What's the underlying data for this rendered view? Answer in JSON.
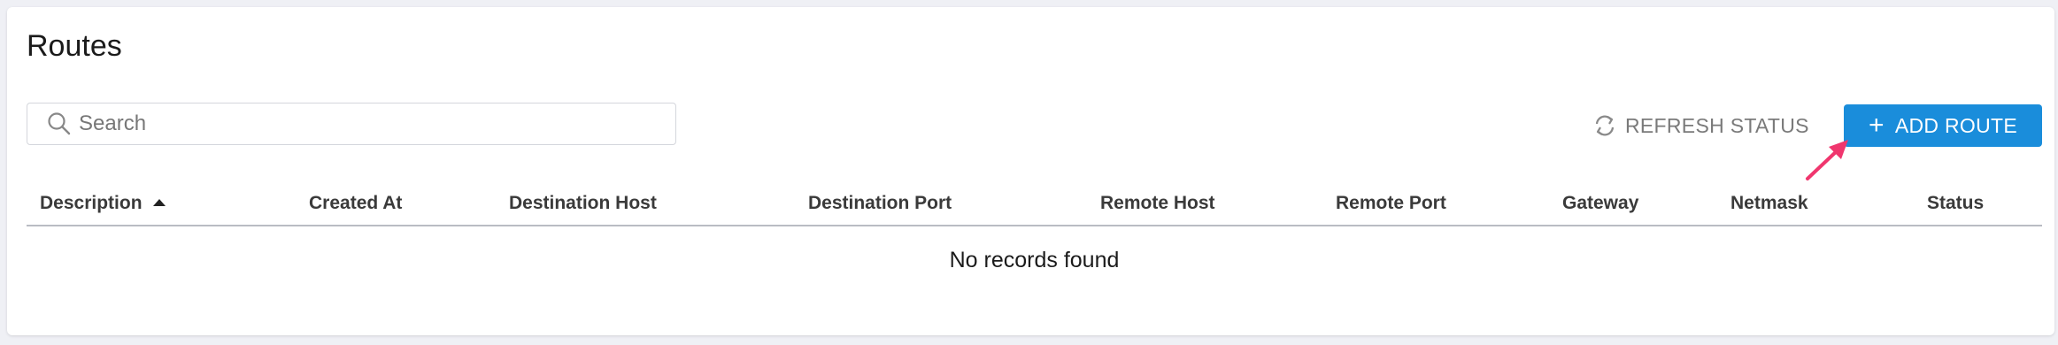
{
  "page": {
    "title": "Routes"
  },
  "search": {
    "placeholder": "Search",
    "value": ""
  },
  "toolbar": {
    "refresh_label": "REFRESH STATUS",
    "add_label": "ADD ROUTE",
    "accent_color": "#1a8ddb",
    "annotation_arrow_color": "#f0366e"
  },
  "table": {
    "columns": [
      {
        "label": "Description",
        "sort": "ascending"
      },
      {
        "label": "Created At"
      },
      {
        "label": "Destination Host"
      },
      {
        "label": "Destination Port"
      },
      {
        "label": "Remote Host"
      },
      {
        "label": "Remote Port"
      },
      {
        "label": "Gateway"
      },
      {
        "label": "Netmask"
      },
      {
        "label": "Status"
      }
    ],
    "rows": [],
    "empty_message": "No records found"
  }
}
